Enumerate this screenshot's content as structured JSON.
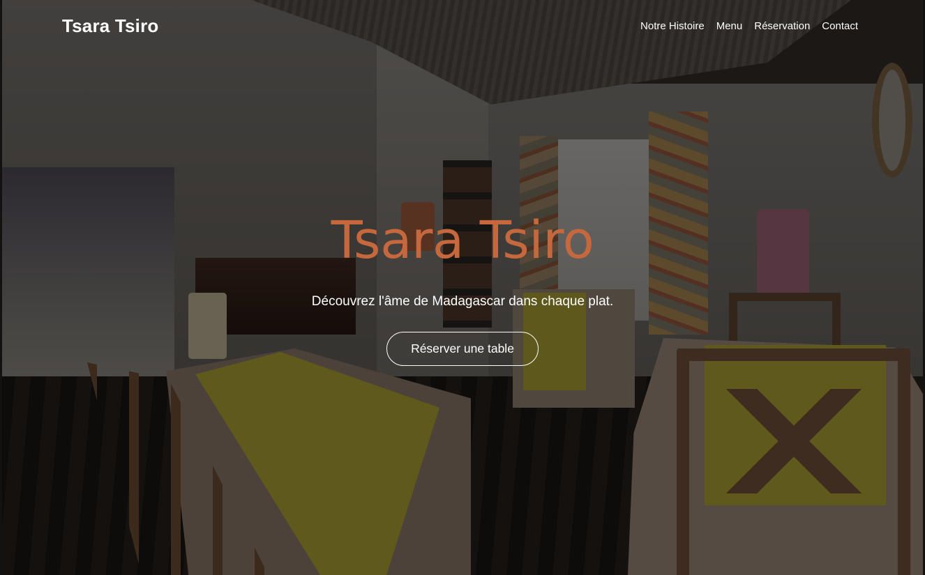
{
  "nav": {
    "brand": "Tsara Tsiro",
    "links": [
      "Notre Histoire",
      "Menu",
      "Réservation",
      "Contact"
    ]
  },
  "hero": {
    "title": "Tsara Tsiro",
    "tagline": "Découvrez l'âme de Madagascar dans chaque plat.",
    "cta_label": "Réserver une table",
    "title_color": "#c5683d",
    "background_image": "restaurant-interior-photo"
  }
}
